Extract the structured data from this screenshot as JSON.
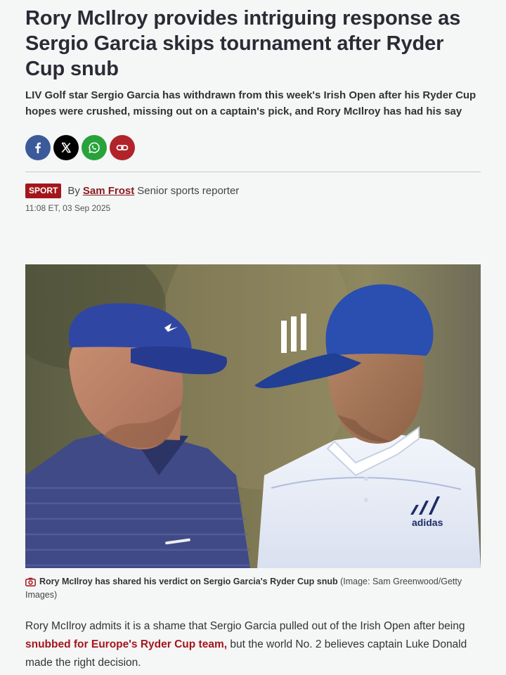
{
  "article": {
    "headline": "Rory McIlroy provides intriguing response as Sergio Garcia skips tournament after Ryder Cup snub",
    "standfirst": "LIV Golf star Sergio Garcia has withdrawn from this week's Irish Open after his Ryder Cup hopes were crushed, missing out on a captain's pick, and Rory McIlroy has had his say",
    "section": "SPORT",
    "byline_prefix": "By",
    "author": "Sam Frost",
    "author_role": "Senior sports reporter",
    "timestamp": "11:08 ET, 03 Sep 2025"
  },
  "share": {
    "icons": [
      "facebook-icon",
      "x-icon",
      "whatsapp-icon",
      "link-icon"
    ],
    "colors": {
      "facebook": "#3b5a9a",
      "x": "#000000",
      "whatsapp": "#28a33c",
      "link": "#b1242a"
    }
  },
  "image": {
    "caption": "Rory McIlroy has shared his verdict on Sergio Garcia's Ryder Cup snub",
    "credit": "(Image: Sam Greenwood/Getty Images)",
    "brand_mark": "adidas"
  },
  "body": {
    "p1_before": "Rory McIlroy admits it is a shame that Sergio Garcia pulled out of the Irish Open after being ",
    "p1_link": "snubbed for Europe's Ryder Cup team,",
    "p1_after": " but the world No. 2 believes captain Luke Donald made the right decision."
  },
  "colors": {
    "accent": "#a3161b",
    "background": "#f5f6f6",
    "text": "#2c2a35"
  }
}
